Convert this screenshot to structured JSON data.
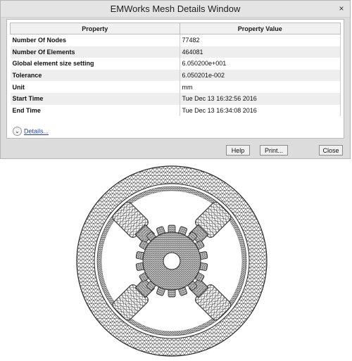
{
  "window": {
    "title": "EMWorks Mesh Details Window",
    "close_glyph": "×"
  },
  "table": {
    "headers": [
      "Property",
      "Property Value"
    ],
    "rows": [
      {
        "property": "Number Of Nodes",
        "value": "77482"
      },
      {
        "property": "Number Of Elements",
        "value": "464081"
      },
      {
        "property": "Global element size setting",
        "value": "6.050200e+001"
      },
      {
        "property": "Tolerance",
        "value": "6.050201e-002"
      },
      {
        "property": "Unit",
        "value": "mm"
      },
      {
        "property": "Start Time",
        "value": "Tue Dec 13 16:32:56 2016"
      },
      {
        "property": "End Time",
        "value": "Tue Dec 13 16:34:08 2016"
      }
    ]
  },
  "details": {
    "label": "Details...",
    "icon": "chevron-down-icon"
  },
  "buttons": {
    "help": "Help",
    "print": "Print...",
    "close": "Close"
  },
  "colors": {
    "mesh_line": "#3a3a3a",
    "link": "#1f3ea6"
  }
}
